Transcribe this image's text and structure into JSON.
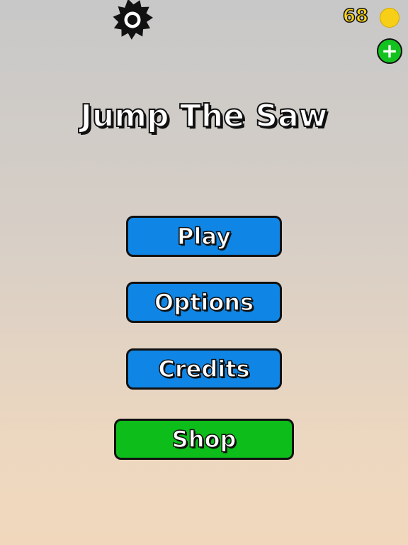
{
  "hud": {
    "coins": "68",
    "add_label": "+"
  },
  "title": "Jump The Saw",
  "menu": {
    "play": "Play",
    "options": "Options",
    "credits": "Credits",
    "shop": "Shop"
  },
  "colors": {
    "play_button": "#0f86e6",
    "shop_button": "#0dbd1a",
    "coin": "#f6cf16",
    "add_button": "#13c21f"
  },
  "icons": [
    "saw-blade-icon",
    "coin-icon",
    "plus-icon"
  ]
}
